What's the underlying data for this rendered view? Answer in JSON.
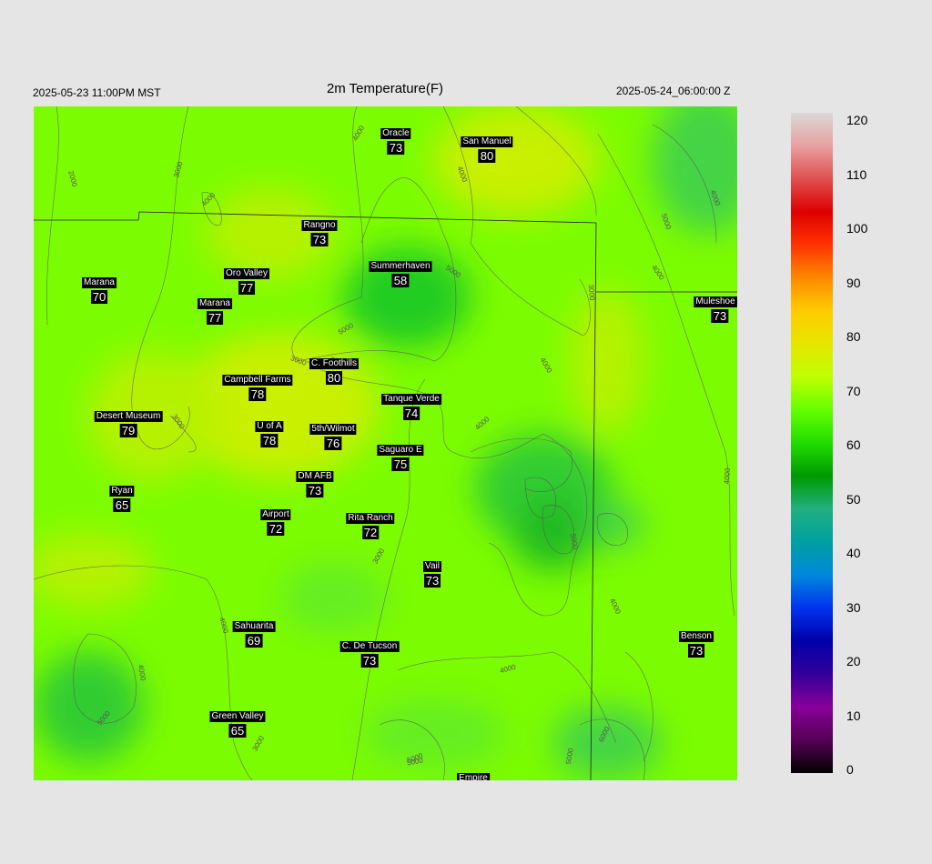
{
  "header": {
    "title": "2m Temperature(F)",
    "local_time": "2025-05-23 11:00PM MST",
    "utc_time": "2025-05-24_06:00:00 Z"
  },
  "stations": [
    {
      "name": "Oracle",
      "value": "73"
    },
    {
      "name": "San Manuel",
      "value": "80"
    },
    {
      "name": "Rangno",
      "value": "73"
    },
    {
      "name": "Oro Valley",
      "value": "77"
    },
    {
      "name": "Summerhaven",
      "value": "58"
    },
    {
      "name": "Marana",
      "value": "70"
    },
    {
      "name": "Marana",
      "value": "77"
    },
    {
      "name": "Muleshoe R",
      "value": "73"
    },
    {
      "name": "C. Foothills",
      "value": "80"
    },
    {
      "name": "Campbell Farms",
      "value": "78"
    },
    {
      "name": "Tanque Verde",
      "value": "74"
    },
    {
      "name": "Desert Museum",
      "value": "79"
    },
    {
      "name": "U of A",
      "value": "78"
    },
    {
      "name": "5th/Wilmot",
      "value": "76"
    },
    {
      "name": "Saguaro E",
      "value": "75"
    },
    {
      "name": "DM AFB",
      "value": "73"
    },
    {
      "name": "Ryan",
      "value": "65"
    },
    {
      "name": "Airport",
      "value": "72"
    },
    {
      "name": "Rita Ranch",
      "value": "72"
    },
    {
      "name": "Vail",
      "value": "73"
    },
    {
      "name": "Sahuarita",
      "value": "69"
    },
    {
      "name": "C. De Tucson",
      "value": "73"
    },
    {
      "name": "Benson",
      "value": "73"
    },
    {
      "name": "Green Valley",
      "value": "65"
    },
    {
      "name": "Empire",
      "value": ""
    }
  ],
  "contour_labels": [
    "2000",
    "3000",
    "4000",
    "4000",
    "4000",
    "5000",
    "4000",
    "5000",
    "3000",
    "3000",
    "5000",
    "3000",
    "4000",
    "4000",
    "5000",
    "3000",
    "4000",
    "4000",
    "4000",
    "5000",
    "5000",
    "5000",
    "6000",
    "4000",
    "5000",
    "4000",
    "4000",
    "3000",
    "5000"
  ],
  "colorbar": {
    "ticks": [
      "120",
      "110",
      "100",
      "90",
      "80",
      "70",
      "60",
      "50",
      "40",
      "30",
      "20",
      "10",
      "0"
    ],
    "colors": [
      "#d9d9d9",
      "#e8a0a0",
      "#e05050",
      "#dd0000",
      "#ff3300",
      "#ff8800",
      "#ffcc00",
      "#e6e600",
      "#bfff00",
      "#66ff00",
      "#22dd00",
      "#009900",
      "#22b080",
      "#00a0a0",
      "#0088dd",
      "#0033ee",
      "#0000aa",
      "#330099",
      "#880099",
      "#550055",
      "#000000"
    ]
  },
  "legend_colors": {
    "map_background": "#7cfc00",
    "warm": "#c8f000",
    "cool": "#33cc33",
    "contour": "#555555",
    "county_line": "#222222"
  }
}
